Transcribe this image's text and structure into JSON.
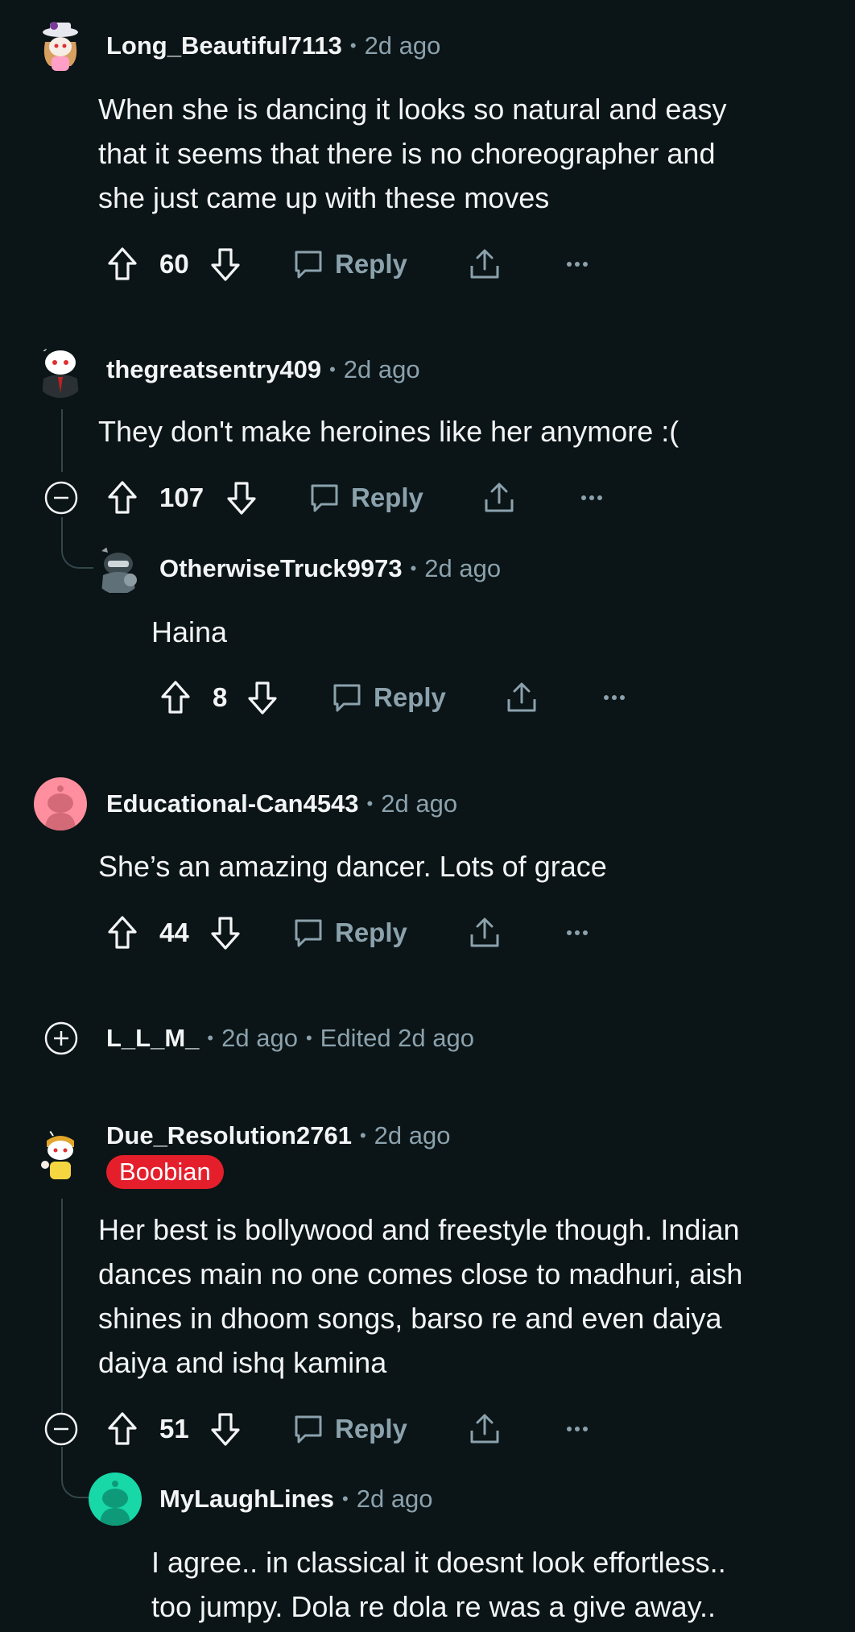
{
  "comments": [
    {
      "username": "Long_Beautiful7113",
      "time": "2d ago",
      "avatar": "snoo-avatar-hat",
      "text_lines": [
        "When she is dancing it looks so natural and easy",
        "that it seems that there is no choreographer and",
        "she just came up with these moves"
      ],
      "votes": "60",
      "reply_label": "Reply"
    },
    {
      "username": "thegreatsentry409",
      "time": "2d ago",
      "avatar": "snoo-avatar-suit",
      "text_lines": [
        "They don't make heroines like her anymore :("
      ],
      "votes": "107",
      "reply_label": "Reply"
    },
    {
      "username": "OtherwiseTruck9973",
      "time": "2d ago",
      "avatar": "snoo-avatar-armor",
      "text_lines": [
        "Haina"
      ],
      "votes": "8",
      "reply_label": "Reply"
    },
    {
      "username": "Educational-Can4543",
      "time": "2d ago",
      "avatar": "default-avatar-pink",
      "text_lines": [
        "She’s an amazing dancer.  Lots of grace"
      ],
      "votes": "44",
      "reply_label": "Reply"
    },
    {
      "username": "L_L_M_",
      "time": "2d ago",
      "edited": "Edited 2d ago",
      "collapsed": true
    },
    {
      "username": "Due_Resolution2761",
      "time": "2d ago",
      "avatar": "snoo-avatar-yellow",
      "flair": "Boobian",
      "text_lines": [
        "Her best is bollywood and freestyle though. Indian",
        "dances main no one comes close to madhuri, aish",
        "shines in dhoom songs, barso re and even daiya",
        "daiya and ishq kamina"
      ],
      "votes": "51",
      "reply_label": "Reply"
    },
    {
      "username": "MyLaughLines",
      "time": "2d ago",
      "avatar": "default-avatar-teal",
      "text_lines": [
        "I agree.. in classical it doesnt look effortless..",
        "too jumpy. Dola re dola re was a give away.."
      ]
    }
  ],
  "icons": {
    "upvote": "upvote-arrow-icon",
    "downvote": "downvote-arrow-icon",
    "reply": "speech-bubble-icon",
    "share": "share-icon",
    "more": "ellipsis-icon",
    "collapse": "minus-circle-icon",
    "expand": "plus-circle-icon"
  },
  "colors": {
    "background": "#0b1416",
    "text": "#f2f4f5",
    "muted": "#8ba2ad",
    "flair": "#e41f2b",
    "thread_line": "#33464c"
  }
}
